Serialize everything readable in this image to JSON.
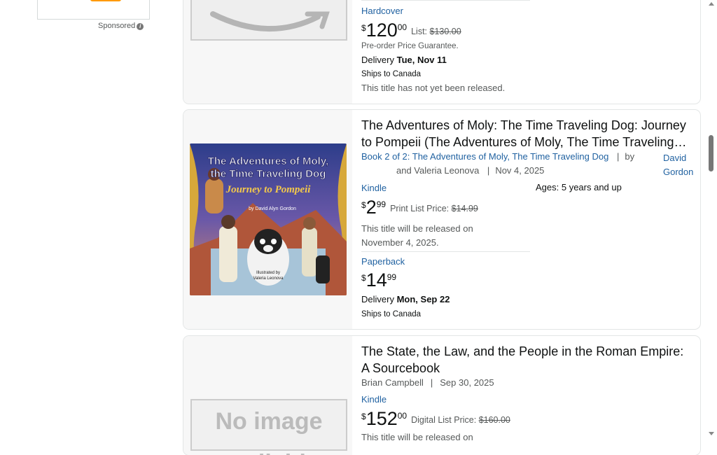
{
  "sponsored": {
    "label": "Sponsored",
    "info": "i"
  },
  "cards": [
    {
      "format": "Hardcover",
      "price": {
        "sym": "$",
        "whole": "120",
        "frac": "00"
      },
      "list_label": "List:",
      "list_price": "$130.00",
      "guarantee": "Pre-order Price Guarantee.",
      "delivery_label": "Delivery",
      "delivery_date": "Tue, Nov 11",
      "ships": "Ships to Canada",
      "not_released": "This title has not yet been released."
    },
    {
      "title": "The Adventures of Moly: The Time Traveling Dog: Journey to Pompeii (The Adventures of Moly, The Time Traveling…",
      "series": "Book 2 of 2: The Adventures of Moly, The Time Traveling Dog",
      "sep": "|",
      "by": "by",
      "author1": "David Gordon",
      "and_author2": "and Valeria Leonova",
      "date": "Nov 4, 2025",
      "ages": "Ages: 5 years and up",
      "cover": {
        "title_line1": "The Adventures of Moly,",
        "title_line2": "the Time Traveling Dog",
        "subtitle": "Journey to Pompeii",
        "author": "by David Alyn Gordon",
        "illustrator_label": "Illustrated by",
        "illustrator": "Valeria Leonova"
      },
      "kindle": {
        "label": "Kindle",
        "price": {
          "sym": "$",
          "whole": "2",
          "frac": "99"
        },
        "list_label": "Print List Price:",
        "list_price": "$14.99",
        "release": "This title will be released on November 4, 2025."
      },
      "paperback": {
        "label": "Paperback",
        "price": {
          "sym": "$",
          "whole": "14",
          "frac": "99"
        },
        "delivery_label": "Delivery",
        "delivery_date": "Mon, Sep 22",
        "ships": "Ships to Canada"
      }
    },
    {
      "title": "The State, the Law, and the People in the Roman Empire: A Sourcebook",
      "author": "Brian Campbell",
      "sep": "|",
      "date": "Sep 30, 2025",
      "kindle": {
        "label": "Kindle",
        "price": {
          "sym": "$",
          "whole": "152",
          "frac": "00"
        },
        "list_label": "Digital List Price:",
        "list_price": "$160.00",
        "release": "This title will be released on"
      },
      "no_image": "No image available"
    }
  ]
}
